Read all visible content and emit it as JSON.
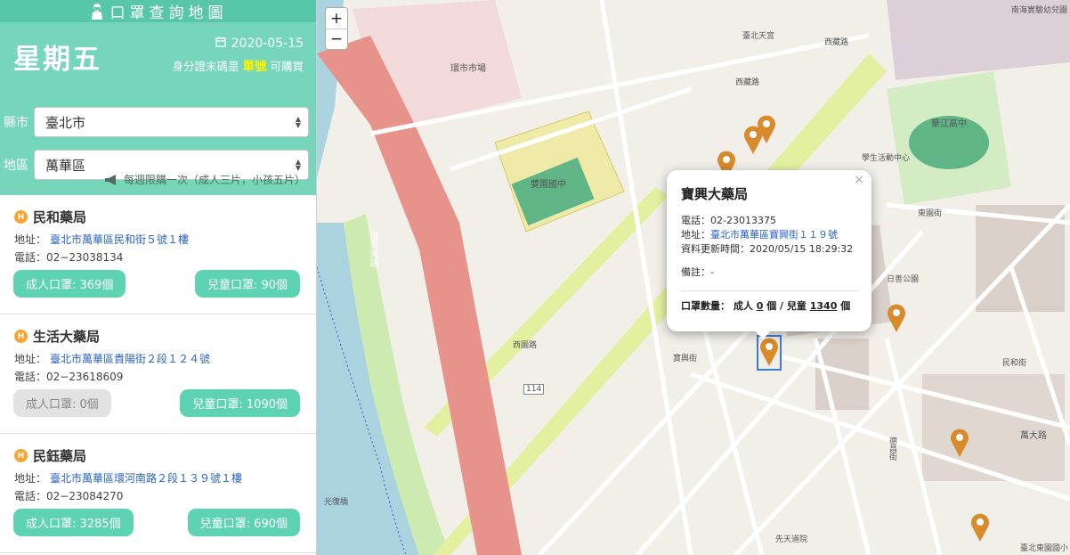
{
  "app": {
    "title": "口罩查詢地圖"
  },
  "header": {
    "weekday": "星期五",
    "date": "2020-05-15",
    "id_rule_prefix": "身分證末碼是",
    "id_rule_highlight": "單號",
    "id_rule_suffix": "可購買",
    "county_label": "縣市",
    "county_value": "臺北市",
    "district_label": "地區",
    "district_value": "萬華區",
    "notice": "每週限購一次（成人三片，小孩五片）"
  },
  "pharmacies": [
    {
      "name": "民和藥局",
      "address_label": "地址：",
      "address": "臺北市萬華區民和街５號１樓",
      "phone_label": "電話：",
      "phone": "02−23038134",
      "adult": "成人口罩: 369個",
      "child": "兒童口罩: 90個"
    },
    {
      "name": "生活大藥局",
      "address_label": "地址：",
      "address": "臺北市萬華區貴陽街２段１２４號",
      "phone_label": "電話：",
      "phone": "02−23618609",
      "adult": "成人口罩: 0個",
      "child": "兒童口罩: 1090個"
    },
    {
      "name": "民鈺藥局",
      "address_label": "地址：",
      "address": "臺北市萬華區環河南路２段１３９號１樓",
      "phone_label": "電話：",
      "phone": "02−23084270",
      "adult": "成人口罩: 3285個",
      "child": "兒童口罩: 690個"
    }
  ],
  "map": {
    "zoom_in": "+",
    "zoom_out": "−",
    "labels": {
      "market": "環市市場",
      "nursery": "南海實驗幼兒園",
      "school": "雙園國中",
      "hwajiang": "華江高中",
      "aihwa": "臺北天宮",
      "xizang_road": "西藏路",
      "xizang_road2": "西藏路",
      "huanhe_south": "環河南路",
      "wanda": "萬大路",
      "xiyuan": "西園路",
      "baoxing": "寶興街",
      "minhe": "民和街",
      "dongyuan": "東園街",
      "hongde": "德昌街",
      "xianfeng": "先天道院",
      "linsen": "臺北東園國小",
      "sport": "學生活動中心",
      "lifeng": "日善公園",
      "road_114": "114",
      "xinhe": "光復橋"
    },
    "popup": {
      "close": "×",
      "name": "寶興大藥局",
      "phone_label": "電話：",
      "phone": "02-23013375",
      "address_label": "地址：",
      "address": "臺北市萬華區寶興街１１９號",
      "updated_label": "資料更新時間：",
      "updated": "2020/05/15 18:29:32",
      "note_label": "備註：",
      "note": "-",
      "qty_label": "口罩數量：",
      "adult_label": "成人",
      "adult_count": "0",
      "unit": "個",
      "separator": "/",
      "child_label": "兒童",
      "child_count": "1340",
      "unit2": "個"
    }
  },
  "colors": {
    "brand_dark": "#58c6a9",
    "brand_light": "#75d6bb",
    "button": "#5dd3b4",
    "button_disabled": "#e2e2e2",
    "highlight": "#fff200",
    "pin": "#d98a2b"
  }
}
